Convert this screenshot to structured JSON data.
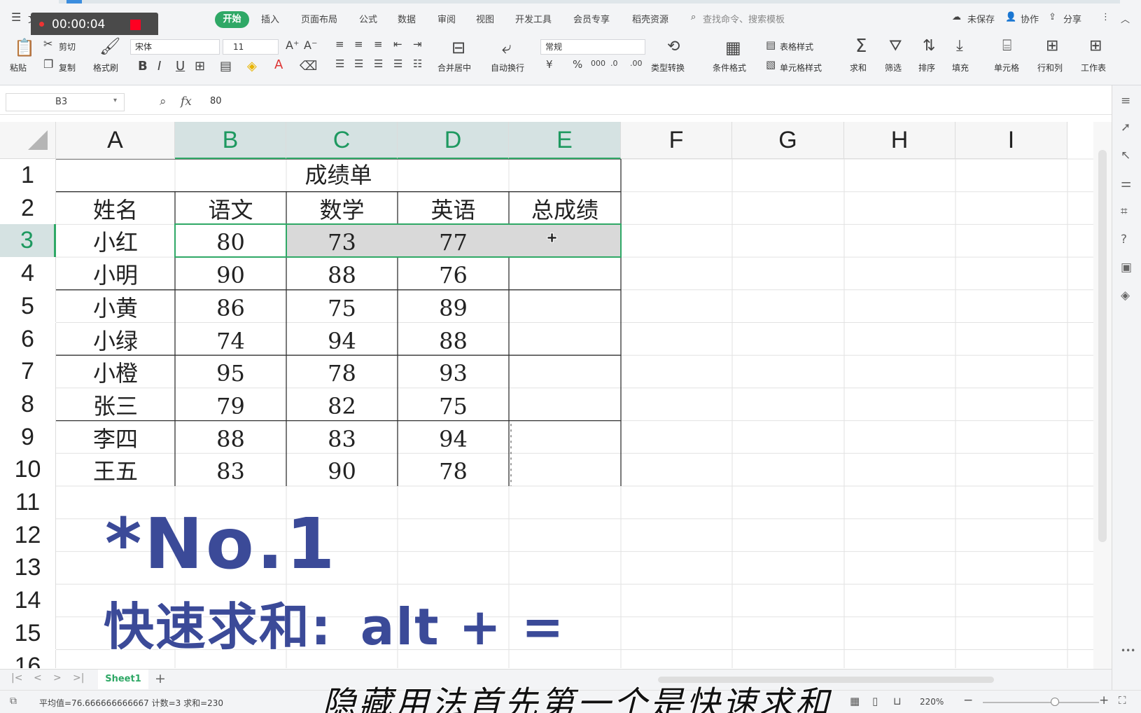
{
  "menu": {
    "file": "文件",
    "active_tab": "开始",
    "tabs": [
      "插入",
      "页面布局",
      "公式",
      "数据",
      "审阅",
      "视图",
      "开发工具",
      "会员专享",
      "稻壳资源"
    ],
    "search": "查找命令、搜索模板",
    "unsaved": "未保存",
    "collab": "协作",
    "share": "分享"
  },
  "recording": {
    "time": "00:00:04"
  },
  "ribbon": {
    "paste": "粘贴",
    "cut": "剪切",
    "copy": "复制",
    "format_painter": "格式刷",
    "font_name": "宋体",
    "font_size": "11",
    "merge_center": "合并居中",
    "wrap_text": "自动换行",
    "number_format": "常规",
    "type_convert": "类型转换",
    "conditional_format": "条件格式",
    "table_style": "表格样式",
    "cell_style": "单元格样式",
    "sum": "求和",
    "filter": "筛选",
    "sort": "排序",
    "fill": "填充",
    "cell": "单元格",
    "row_col": "行和列",
    "worksheet": "工作表"
  },
  "formula_bar": {
    "cell_ref": "B3",
    "value": "80"
  },
  "sheet": {
    "columns": [
      "A",
      "B",
      "C",
      "D",
      "E",
      "F",
      "G",
      "H",
      "I"
    ],
    "rows": [
      "1",
      "2",
      "3",
      "4",
      "5",
      "6",
      "7",
      "8",
      "9",
      "10",
      "11",
      "12",
      "13",
      "14",
      "15",
      "16"
    ],
    "title": "成绩单",
    "headers": [
      "姓名",
      "语文",
      "数学",
      "英语",
      "总成绩"
    ],
    "data": [
      [
        "小红",
        "80",
        "73",
        "77"
      ],
      [
        "小明",
        "90",
        "88",
        "76"
      ],
      [
        "小黄",
        "86",
        "75",
        "89"
      ],
      [
        "小绿",
        "74",
        "94",
        "88"
      ],
      [
        "小橙",
        "95",
        "78",
        "93"
      ],
      [
        "张三",
        "79",
        "82",
        "75"
      ],
      [
        "李四",
        "88",
        "83",
        "94"
      ],
      [
        "王五",
        "83",
        "90",
        "78"
      ]
    ]
  },
  "overlay": {
    "number": "*No.1",
    "tip": "快速求和:",
    "shortcut": "alt + =",
    "subtitle": "隐藏用法首先第一个是快速求和"
  },
  "tabs": {
    "sheet1": "Sheet1",
    "add": "+"
  },
  "status": {
    "summary": "平均值=76.666666666667  计数=3  求和=230",
    "zoom": "220%"
  }
}
